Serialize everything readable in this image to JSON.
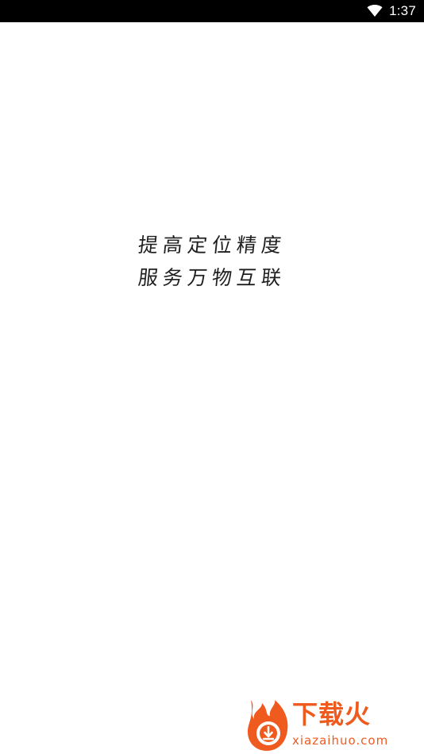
{
  "status_bar": {
    "time": "1:37",
    "icons": [
      "wifi-icon"
    ]
  },
  "splash": {
    "line1": "提高定位精度",
    "line2": "服务万物互联"
  },
  "watermark": {
    "brand": "下载火",
    "url": "xiazaihuo.com",
    "accent_color": "#ef5a1f"
  }
}
